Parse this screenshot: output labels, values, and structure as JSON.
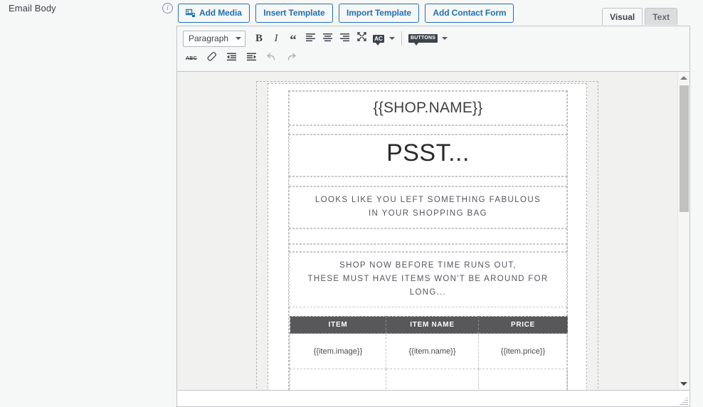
{
  "field": {
    "label": "Email Body",
    "info_icon": "info-circle-icon",
    "info_glyph": "i"
  },
  "media_buttons": [
    {
      "name": "add-media",
      "label": "Add Media",
      "icon": "media-images-icon"
    },
    {
      "name": "insert-template",
      "label": "Insert Template",
      "icon": ""
    },
    {
      "name": "import-template",
      "label": "Import Template",
      "icon": ""
    },
    {
      "name": "add-contact-form",
      "label": "Add Contact Form",
      "icon": ""
    }
  ],
  "editor_tabs": [
    {
      "name": "visual",
      "label": "Visual",
      "active": true
    },
    {
      "name": "text",
      "label": "Text",
      "active": false
    }
  ],
  "toolbar": {
    "format_select": {
      "value": "Paragraph",
      "icon": "chevron-down-icon"
    },
    "row1": [
      {
        "name": "bold",
        "label": "B",
        "icon": "bold-icon",
        "disabled": false
      },
      {
        "name": "italic",
        "label": "I",
        "icon": "italic-icon",
        "disabled": false
      },
      {
        "name": "blockquote",
        "label": "“",
        "icon": "blockquote-icon",
        "disabled": false
      },
      {
        "name": "align-left",
        "label": "",
        "icon": "align-left-icon",
        "disabled": false
      },
      {
        "name": "align-center",
        "label": "",
        "icon": "align-center-icon",
        "disabled": false
      },
      {
        "name": "align-right",
        "label": "",
        "icon": "align-right-icon",
        "disabled": false
      },
      {
        "name": "fullscreen",
        "label": "",
        "icon": "fullscreen-expand-icon",
        "disabled": false
      },
      {
        "name": "text-color",
        "label": "AC",
        "icon": "text-color-icon",
        "disabled": false
      },
      {
        "name": "buttons-dropdown",
        "label": "BUTTONS",
        "icon": "buttons-badge-icon",
        "disabled": false
      }
    ],
    "row2": [
      {
        "name": "strikethrough",
        "label": "ABC",
        "icon": "strikethrough-icon",
        "disabled": false
      },
      {
        "name": "clear-formatting",
        "label": "",
        "icon": "eraser-icon",
        "disabled": false
      },
      {
        "name": "decrease-indent",
        "label": "",
        "icon": "outdent-icon",
        "disabled": false
      },
      {
        "name": "increase-indent",
        "label": "",
        "icon": "indent-icon",
        "disabled": false
      },
      {
        "name": "undo",
        "label": "",
        "icon": "undo-icon",
        "disabled": true
      },
      {
        "name": "redo",
        "label": "",
        "icon": "redo-icon",
        "disabled": true
      }
    ]
  },
  "email_template": {
    "shop_name": "{{SHOP.NAME}}",
    "headline": "PSST...",
    "subhead_line1": "LOOKS LIKE YOU LEFT SOMETHING FABULOUS",
    "subhead_line2": "IN YOUR SHOPPING BAG",
    "urgency_line1": "SHOP NOW BEFORE TIME RUNS OUT,",
    "urgency_line2": "THESE MUST HAVE ITEMS WON'T BE AROUND FOR",
    "urgency_line3": "LONG...",
    "items_table": {
      "headers": [
        "ITEM",
        "ITEM NAME",
        "PRICE"
      ],
      "rows": [
        [
          "{{item.image}}",
          "{{item.name}}",
          "{{item.price}}"
        ],
        [
          "",
          "",
          ""
        ]
      ],
      "header_bg": "#58585a",
      "header_color": "#ffffff"
    }
  },
  "scrollbar": {
    "up_arrow": "scroll-up-arrow-icon",
    "down_arrow": "scroll-down-arrow-icon"
  },
  "colors": {
    "accent_blue": "#2271b1",
    "panel_bg": "#f6f7f7",
    "border": "#c3c4c7",
    "canvas_bg": "#f1f1ef",
    "info_purple": "#8c84b8"
  }
}
